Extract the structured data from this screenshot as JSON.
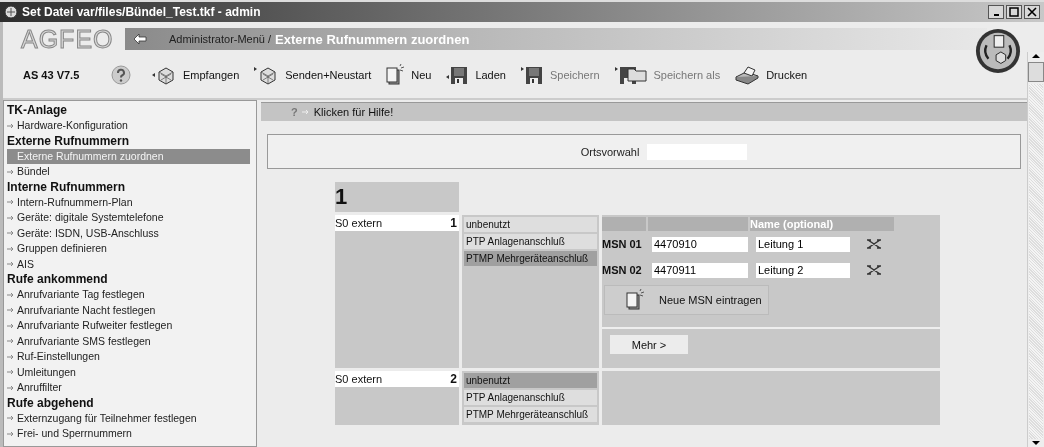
{
  "window": {
    "title": "Set Datei var/files/Bündel_Test.tkf - admin"
  },
  "header": {
    "logo": "AGFEO",
    "breadcrumb": {
      "path": "Administrator-Menü /",
      "current": "Externe Rufnummern zuordnen"
    },
    "device": "AS 43 V7.5",
    "toolbar": [
      {
        "kind": "receive",
        "label": "Empfangen",
        "disabled": false
      },
      {
        "kind": "send",
        "label": "Senden+Neustart",
        "disabled": false
      },
      {
        "kind": "new",
        "label": "Neu",
        "disabled": false
      },
      {
        "kind": "load",
        "label": "Laden",
        "disabled": false
      },
      {
        "kind": "save",
        "label": "Speichern",
        "disabled": true
      },
      {
        "kind": "saveas",
        "label": "Speichern als",
        "disabled": true
      },
      {
        "kind": "print",
        "label": "Drucken",
        "disabled": false
      }
    ]
  },
  "sidebar": [
    {
      "heading": "TK-Anlage",
      "items": [
        {
          "label": "Hardware-Konfiguration",
          "selected": false
        }
      ]
    },
    {
      "heading": "Externe Rufnummern",
      "items": [
        {
          "label": "Externe Rufnummern zuordnen",
          "selected": true
        },
        {
          "label": "Bündel",
          "selected": false
        }
      ]
    },
    {
      "heading": "Interne Rufnummern",
      "items": [
        {
          "label": "Intern-Rufnummern-Plan",
          "selected": false
        },
        {
          "label": "Geräte: digitale Systemtelefone",
          "selected": false
        },
        {
          "label": "Geräte: ISDN, USB-Anschluss",
          "selected": false
        },
        {
          "label": "Gruppen definieren",
          "selected": false
        },
        {
          "label": "AIS",
          "selected": false
        }
      ]
    },
    {
      "heading": "Rufe ankommend",
      "items": [
        {
          "label": "Anrufvariante Tag festlegen",
          "selected": false
        },
        {
          "label": "Anrufvariante Nacht festlegen",
          "selected": false
        },
        {
          "label": "Anrufvariante Rufweiter festlegen",
          "selected": false
        },
        {
          "label": "Anrufvariante SMS festlegen",
          "selected": false
        },
        {
          "label": "Ruf-Einstellungen",
          "selected": false
        },
        {
          "label": "Umleitungen",
          "selected": false
        },
        {
          "label": "Anruffilter",
          "selected": false
        }
      ]
    },
    {
      "heading": "Rufe abgehend",
      "items": [
        {
          "label": "Externzugang für Teilnehmer festlegen",
          "selected": false
        },
        {
          "label": "Frei- und Sperrnummern",
          "selected": false
        }
      ]
    }
  ],
  "help": {
    "icon": "?",
    "text": "Klicken für Hilfe!"
  },
  "ortsvorwahl": {
    "label": "Ortsvorwahl"
  },
  "bundle": {
    "title": "1",
    "lines": [
      {
        "name": "S0 extern",
        "number": "1",
        "modes": [
          {
            "label": "unbenutzt",
            "selected": false
          },
          {
            "label": "PTP Anlagenanschluß",
            "selected": false
          },
          {
            "label": "PTMP Mehrgeräteanschluß",
            "selected": true
          }
        ],
        "msn_panel": {
          "name_header": "Name (optional)",
          "msns": [
            {
              "label": "MSN 01",
              "number": "4470910",
              "name": "Leitung 1"
            },
            {
              "label": "MSN 02",
              "number": "4470911",
              "name": "Leitung 2"
            }
          ],
          "new_button": "Neue MSN eintragen",
          "more_button": "Mehr >"
        }
      },
      {
        "name": "S0 extern",
        "number": "2",
        "modes": [
          {
            "label": "unbenutzt",
            "selected": true
          },
          {
            "label": "PTP Anlagenanschluß",
            "selected": false
          },
          {
            "label": "PTMP Mehrgeräteanschluß",
            "selected": false
          }
        ]
      }
    ]
  }
}
